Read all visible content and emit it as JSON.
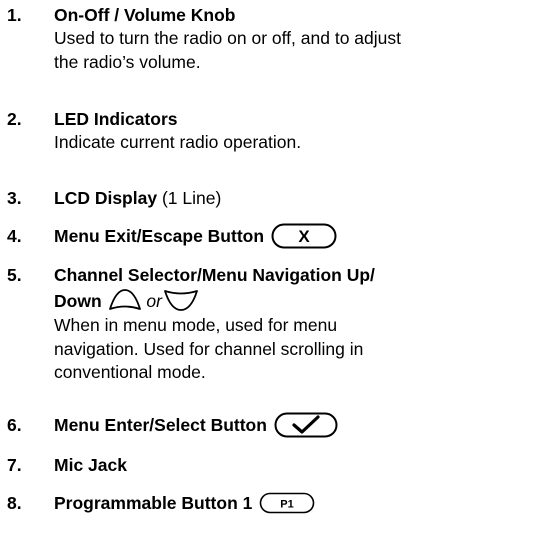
{
  "items": [
    {
      "number": "1.",
      "title": "On-Off / Volume Knob",
      "desc_lines": [
        "Used to turn the radio on or off, and to adjust",
        "the radio’s volume."
      ]
    },
    {
      "number": "2.",
      "title": "LED Indicators",
      "desc_lines": [
        "Indicate current radio operation."
      ]
    },
    {
      "number": "3.",
      "title": "LCD Display",
      "title_suffix": "(1 Line)"
    },
    {
      "number": "4.",
      "title": "Menu Exit/Escape Button",
      "icon": "exit-x-button-icon",
      "icon_label": "X"
    },
    {
      "number": "5.",
      "title_line1": "Channel Selector/Menu Navigation Up/",
      "title_line2": "Down",
      "or_text": "or",
      "icon_up": "arrow-up-button-icon",
      "icon_down": "arrow-down-button-icon",
      "desc_lines": [
        "When in menu mode, used for menu",
        "navigation. Used for channel scrolling in",
        "conventional mode."
      ]
    },
    {
      "number": "6.",
      "title": "Menu Enter/Select Button",
      "icon": "checkmark-select-button-icon"
    },
    {
      "number": "7.",
      "title": "Mic Jack"
    },
    {
      "number": "8.",
      "title": "Programmable Button 1",
      "icon": "p1-button-icon",
      "icon_label": "P1"
    }
  ]
}
